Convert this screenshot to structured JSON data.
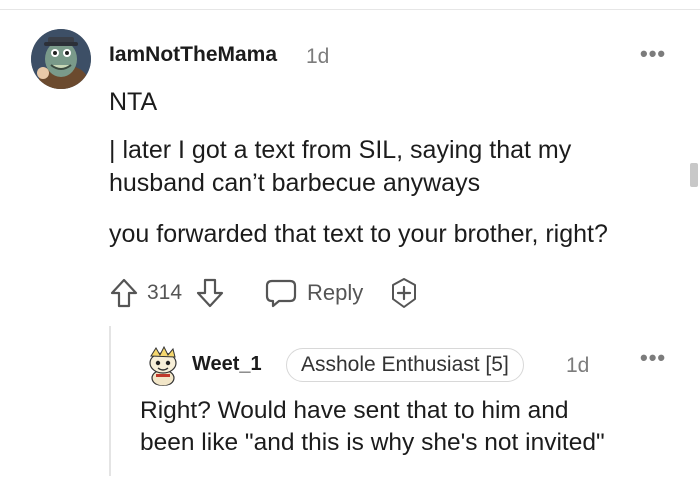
{
  "comment": {
    "username": "IamNotTheMama",
    "time": "1d",
    "more": "•••",
    "body_first": "NTA",
    "quote_line1": "| later I got a text from SIL, saying that my",
    "quote_line2": "husband can’t barbecue anyways",
    "body_last": "you forwarded that text to your brother, right?",
    "score": "314",
    "reply_label": "Reply"
  },
  "reply": {
    "username": "Weet_1",
    "flair": "Asshole Enthusiast [5]",
    "time": "1d",
    "more": "•••",
    "line1": "Right? Would have sent that to him and",
    "line2": "been like \"and this is why she's not invited\""
  },
  "icons": {
    "avatar1": "dinosaur-avatar-icon",
    "avatar2": "snoo-avatar-icon",
    "upvote": "arrow-up-icon",
    "downvote": "arrow-down-icon",
    "reply": "speech-bubble-icon",
    "award": "award-plus-icon"
  },
  "colors": {
    "text": "#1c1c1c",
    "meta": "#7c7c7c",
    "icon": "#555555",
    "flair_border": "#d8d8d8"
  }
}
